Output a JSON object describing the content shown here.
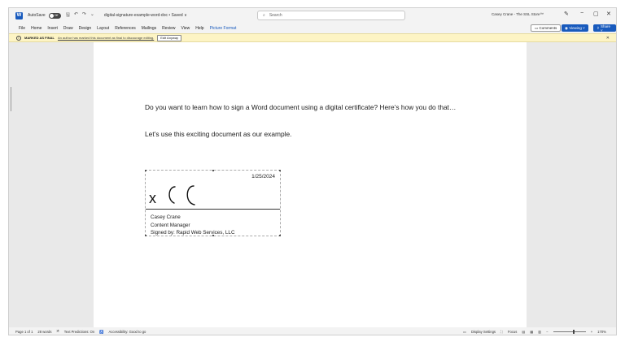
{
  "titlebar": {
    "autosave_label": "AutoSave",
    "autosave_state": "Off",
    "doc_title": "digital-signature-example-word-doc • Saved ∨",
    "search_placeholder": "Search",
    "user_name": "Casey Crane - The SSL Store™"
  },
  "ribbon": {
    "tabs": [
      "File",
      "Home",
      "Insert",
      "Draw",
      "Design",
      "Layout",
      "References",
      "Mailings",
      "Review",
      "View",
      "Help",
      "Picture Format"
    ],
    "comments_label": "Comments",
    "viewing_label": "Viewing ˅",
    "share_label": "Share ˅"
  },
  "infobar": {
    "title": "MARKED AS FINAL",
    "message": "An author has marked this document as final to discourage editing.",
    "edit_button": "Edit Anyway"
  },
  "document": {
    "paragraph1": "Do you want to learn how to sign a Word document using a digital certificate? Here’s how you do that…",
    "paragraph2": "Let’s use this exciting document as our example."
  },
  "signature": {
    "date": "1/25/2024",
    "mark": "x",
    "name": "Casey Crane",
    "title": "Content Manager",
    "signed_by": "Signed by: Rapid Web Services, LLC"
  },
  "statusbar": {
    "page": "Page 1 of 1",
    "words": "28 words",
    "text_predictions": "Text Predictions: On",
    "accessibility": "Accessibility: Good to go",
    "display_settings": "Display Settings",
    "focus": "Focus",
    "zoom": "170%"
  },
  "colors": {
    "accent": "#185abd",
    "infobar": "#fdf4c4"
  }
}
